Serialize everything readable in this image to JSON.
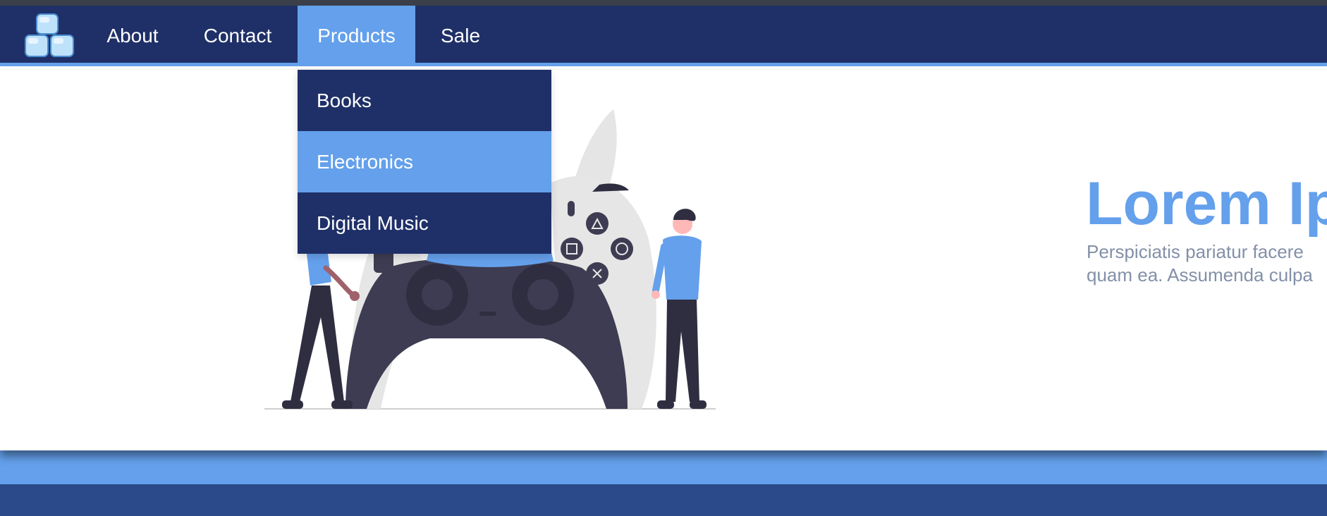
{
  "nav": {
    "logo_icon": "ice-cubes-logo",
    "items": [
      {
        "label": "About"
      },
      {
        "label": "Contact"
      },
      {
        "label": "Products"
      },
      {
        "label": "Sale"
      }
    ],
    "active_item": "Products"
  },
  "dropdown": {
    "items": [
      {
        "label": "Books"
      },
      {
        "label": "Electronics"
      },
      {
        "label": "Digital Music"
      }
    ],
    "highlighted_item": "Electronics"
  },
  "hero": {
    "title": "Lorem Ip",
    "text_line1": "Perspiciatis pariatur facere",
    "text_line2": "quam ea. Assumenda culpa",
    "illustration": "gamer-controller-illustration"
  },
  "colors": {
    "nav_background": "#1f3068",
    "accent": "#64a0eb",
    "footer_background": "#2a4a8a",
    "hero_text": "#8390a8"
  }
}
